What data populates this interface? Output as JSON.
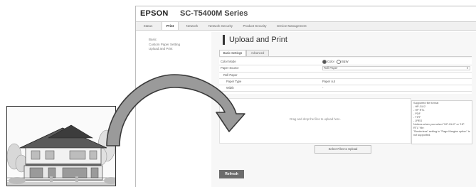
{
  "header": {
    "brand": "EPSON",
    "model": "SC-T5400M Series"
  },
  "tabs": [
    {
      "label": "Status"
    },
    {
      "label": "Print",
      "active": true
    },
    {
      "label": "Network"
    },
    {
      "label": "Network Security"
    },
    {
      "label": "Product Security"
    },
    {
      "label": "Device Management"
    }
  ],
  "subnav": [
    "Basic",
    "Custom Paper Setting",
    "Upload and Print"
  ],
  "page_title": "Upload and Print",
  "settings_tabs": [
    {
      "label": "Basic Settings",
      "active": true
    },
    {
      "label": "Advanced"
    }
  ],
  "form": {
    "color_mode_label": "Color Mode",
    "color_option": "Color",
    "bw_option": "B&W",
    "paper_source_label": "Paper Source",
    "paper_source_value": "Roll Paper",
    "roll_paper_label": "Roll Paper",
    "paper_type_label": "Paper Type",
    "paper_type_value": "Paper cut",
    "width_label": "Width",
    "width_value": "-"
  },
  "dropzone_text": "Drag and drop the files to upload here.",
  "info_text": [
    "Supported file format",
    "- HP-GL/2",
    "- HP RTL",
    "- PDF",
    "- TIFF",
    "- JPEG",
    "Notices when you select \"HP-GL/2\" or \"HP RTL\" file:",
    "\"Borderless\" setting in \"Page Margins option\" is not supported."
  ],
  "select_files_label": "Select Files to Upload",
  "refresh_label": "Refresh",
  "colors": {
    "ui_grey": "#6c6c6c",
    "border": "#cfcfcf"
  }
}
